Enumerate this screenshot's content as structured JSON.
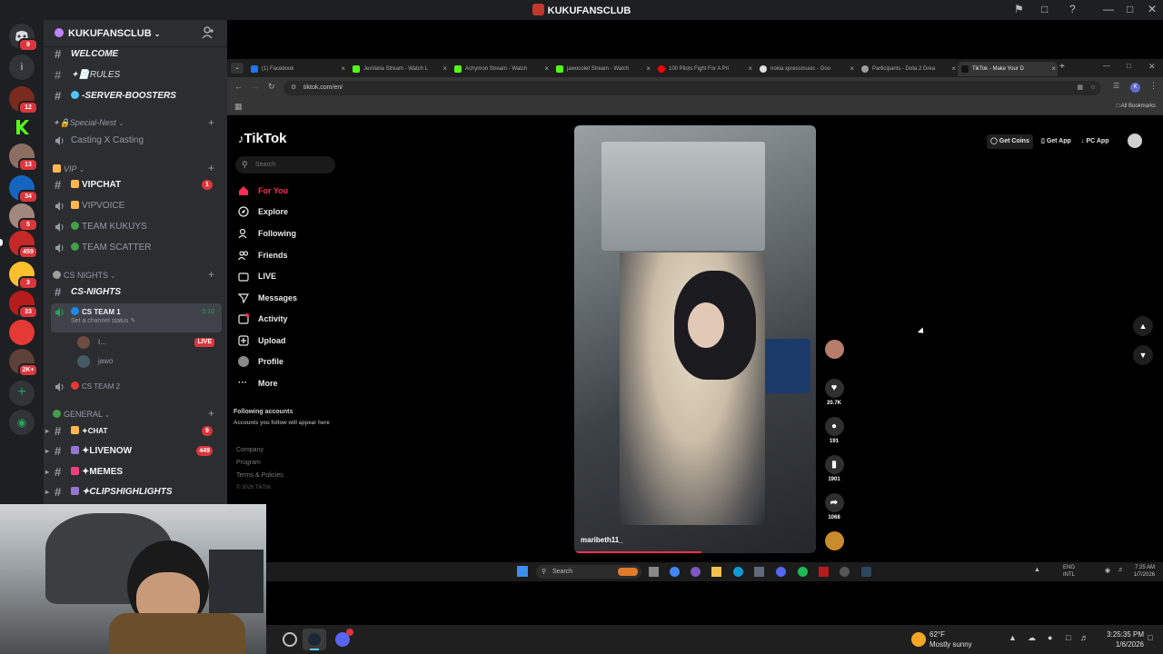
{
  "window": {
    "title": "KUKUFANSCLUB"
  },
  "server_rail": {
    "badges": [
      "9",
      "12",
      "13",
      "34",
      "5",
      "459",
      "3",
      "33",
      "2K+"
    ]
  },
  "sidebar": {
    "server_name": "KUKUFANSCLUB",
    "channels_top": [
      {
        "name": "WELCOME"
      },
      {
        "name": "✦📄RULES"
      },
      {
        "name": "SERVER-BOOSTERS"
      }
    ],
    "categories": {
      "special_nest": "✦🔒Special-Nest",
      "vip": "VIP",
      "cs_nights": "CS NIGHTS",
      "general": "GENERAL"
    },
    "casting": "Casting X Casting",
    "vip_channels": [
      {
        "name": "VIPCHAT",
        "badge": "1"
      },
      {
        "name": "VIPVOICE"
      },
      {
        "name": "TEAM KUKUYS"
      },
      {
        "name": "TEAM SCATTER"
      }
    ],
    "cs_nights_channel": "CS-NIGHTS",
    "cs_team1": {
      "name": "CS TEAM 1",
      "time": "5:10",
      "status": "Set a channel status"
    },
    "voice_users": [
      {
        "name": "t...",
        "live": "LIVE"
      },
      {
        "name": "jawo"
      }
    ],
    "cs_team2": "CS TEAM 2",
    "general_channels": [
      {
        "name": "✦CHAT",
        "badge": "9"
      },
      {
        "name": "✦LIVENOW",
        "badge": "449"
      },
      {
        "name": "✦MEMES"
      },
      {
        "name": "✦CLIPSHIGHLIGHTS"
      }
    ]
  },
  "browser": {
    "tabs": [
      "(1) Facebook",
      "JesVaria Stream - Watch L",
      "Achymon Stream - Watch",
      "jawocolet Stream - Watch",
      "100 Pilots Fight For A Pri",
      "nokia xpressmusic - Goo",
      "Participants - Dota 2 Drea",
      "TikTok - Make Your D"
    ],
    "url": "tiktok.com/en/",
    "bookmarks": "All Bookmarks"
  },
  "tiktok": {
    "logo": "TikTok",
    "search_placeholder": "Search",
    "nav": [
      "For You",
      "Explore",
      "Following",
      "Friends",
      "LIVE",
      "Messages",
      "Activity",
      "Upload",
      "Profile",
      "More"
    ],
    "following_title": "Following accounts",
    "following_sub": "Accounts you follow will appear here",
    "footer": [
      "Company",
      "Program",
      "Terms & Policies",
      "© 2026 TikTok"
    ],
    "top_buttons": [
      "Get Coins",
      "Get App",
      "PC App"
    ],
    "username": "maribeth11_",
    "likes": "20.7K",
    "comments": "191",
    "saves": "1901",
    "shares": "1068"
  },
  "inner_taskbar": {
    "search": "Search",
    "lang": "ENG",
    "lang2": "INTL",
    "time": "7:25 AM",
    "date": "1/7/2026"
  },
  "taskbar": {
    "weather_temp": "62°F",
    "weather_desc": "Mostly sunny",
    "time": "3:25:35 PM",
    "date": "1/6/2026"
  },
  "colors": {
    "discord_bg": "#2b2d31",
    "rail_bg": "#1e1f22",
    "badge_red": "#da373c",
    "tiktok_red": "#fe2c55",
    "live_green": "#23a55a"
  }
}
